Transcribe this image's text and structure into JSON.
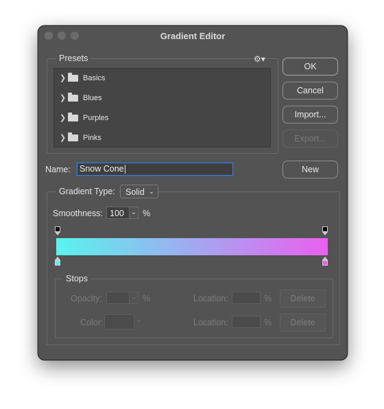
{
  "window": {
    "title": "Gradient Editor"
  },
  "presets": {
    "label": "Presets",
    "settings_icon": "gear-icon",
    "items": [
      {
        "label": "Basics",
        "icon": "folder-icon"
      },
      {
        "label": "Blues",
        "icon": "folder-icon"
      },
      {
        "label": "Purples",
        "icon": "folder-icon"
      },
      {
        "label": "Pinks",
        "icon": "folder-icon"
      }
    ]
  },
  "buttons": {
    "ok": "OK",
    "cancel": "Cancel",
    "import": "Import...",
    "export": "Export...",
    "new": "New"
  },
  "name": {
    "label": "Name:",
    "value": "Snow Cone"
  },
  "gradient_type": {
    "label": "Gradient Type:",
    "value": "Solid"
  },
  "smoothness": {
    "label": "Smoothness:",
    "value": "100",
    "unit": "%"
  },
  "gradient": {
    "start_color": "#58f4ee",
    "end_color": "#ea5ff0",
    "opacity_stops": [
      "#000000",
      "#000000"
    ],
    "color_stops": [
      "#58f4ee",
      "#ea5ff0"
    ]
  },
  "stops": {
    "label": "Stops",
    "opacity_label": "Opacity:",
    "opacity_unit": "%",
    "opacity_location_label": "Location:",
    "opacity_location_unit": "%",
    "opacity_delete": "Delete",
    "color_label": "Color:",
    "color_location_label": "Location:",
    "color_location_unit": "%",
    "color_delete": "Delete"
  }
}
